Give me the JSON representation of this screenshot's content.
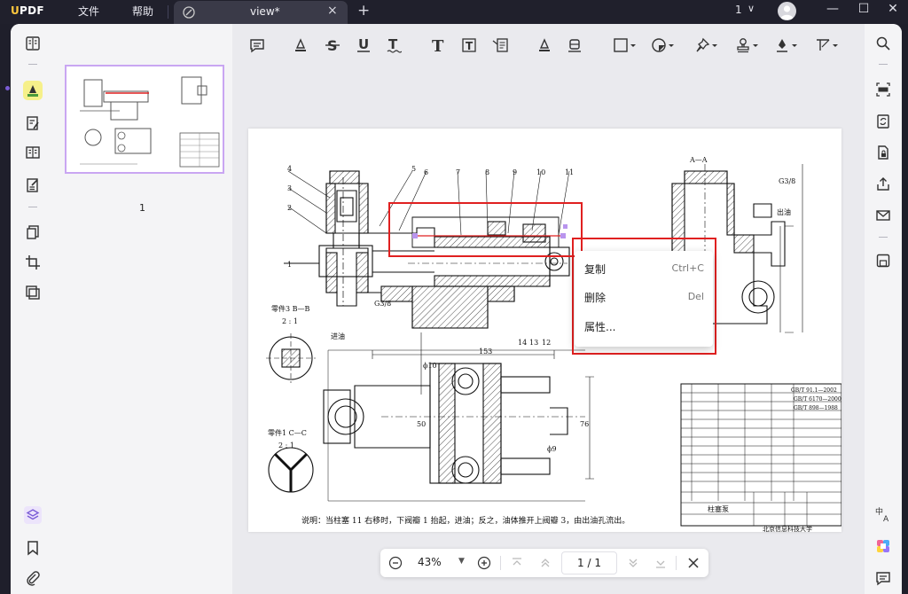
{
  "app": {
    "logo_u": "U",
    "logo_rest": "PDF"
  },
  "menu": {
    "file": "文件",
    "help": "帮助"
  },
  "tab": {
    "title": "view*",
    "close": "×",
    "new": "+"
  },
  "window": {
    "count": "1",
    "chevron": "∨",
    "minimize": "—",
    "maximize": "☐",
    "close": "✕"
  },
  "thumbnail": {
    "page_number": "1"
  },
  "context_menu": {
    "items": [
      {
        "label": "复制",
        "shortcut": "Ctrl+C"
      },
      {
        "label": "删除",
        "shortcut": "Del"
      },
      {
        "label": "属性...",
        "shortcut": ""
      }
    ]
  },
  "bottom_bar": {
    "zoom": "43%",
    "page_indicator": "1 / 1"
  },
  "drawing": {
    "note": "说明：当柱塞 11 右移时，下阀瓣 1 抬起，进油；反之，油体推开上阀瓣 3，由出油孔流出。",
    "school": "北京信息科技大学",
    "part_name": "柱塞泵",
    "section_ab": "A—A",
    "thread": "G3/8",
    "outlet": "出油",
    "inlet": "进油",
    "dim_153": "153",
    "dim_76": "76",
    "dim_phi10": "ϕ10",
    "dim_phi9": "ϕ9",
    "dim_50": "50",
    "view_b": "零件3 B—B",
    "view_c": "零件1 C—C",
    "ratio": "2 : 1",
    "callouts": [
      "4",
      "3",
      "2",
      "1",
      "5",
      "6",
      "7",
      "8",
      "9",
      "10",
      "11",
      "14",
      "13",
      "12"
    ],
    "bom_standards": [
      "GB/T 91.1—2002",
      "GB/T 6170—2000",
      "GB/T 898—1988"
    ]
  },
  "colors": {
    "accent": "#e02020",
    "highlight": "#f6f08a",
    "selection_purple": "#c9a6f2",
    "brand": "#ffc83d"
  }
}
